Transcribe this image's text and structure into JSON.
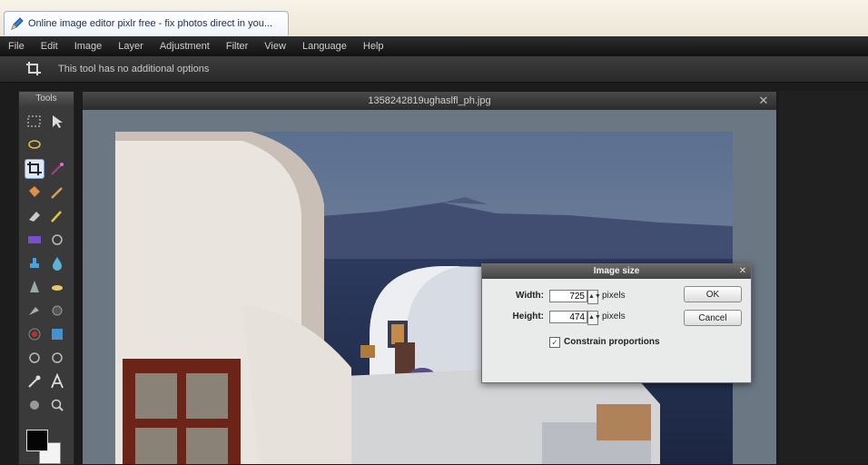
{
  "browser": {
    "tab_title": "Online image editor pixlr free - fix photos direct in you..."
  },
  "menu": [
    "File",
    "Edit",
    "Image",
    "Layer",
    "Adjustment",
    "Filter",
    "View",
    "Language",
    "Help"
  ],
  "options_bar": {
    "text": "This tool has no additional options"
  },
  "tools_panel": {
    "title": "Tools",
    "active_tool": "crop",
    "primary_color": "#050505",
    "secondary_color": "#f3f3f3"
  },
  "document": {
    "title": "1358242819ughaslfl_ph.jpg"
  },
  "dialog": {
    "title": "Image size",
    "width_label": "Width:",
    "width_value": "725",
    "height_label": "Height:",
    "height_value": "474",
    "unit": "pixels",
    "ok_label": "OK",
    "cancel_label": "Cancel",
    "constrain_label": "Constrain proportions",
    "constrain_checked": true
  },
  "colors": {
    "menu_bg": "#111111",
    "canvas_bg": "#6b7883",
    "dialog_bg": "#e9eaea"
  }
}
